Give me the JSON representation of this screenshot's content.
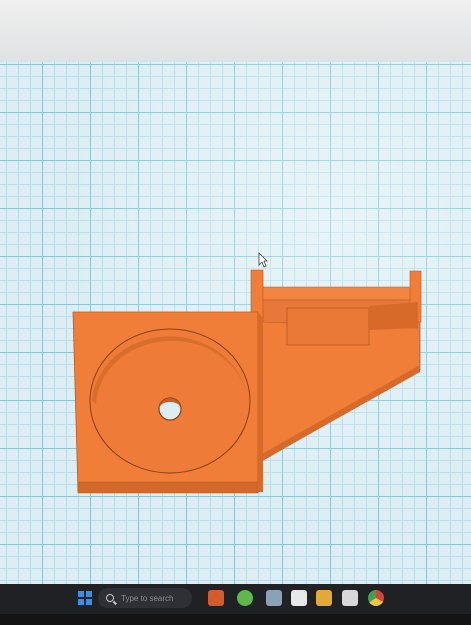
{
  "taskbar": {
    "search_placeholder": "Type to search",
    "apps": [
      {
        "name": "files-app-icon",
        "color": "#d65a2c"
      },
      {
        "name": "photos-app-icon",
        "color": "#5fb84a"
      },
      {
        "name": "explorer-icon",
        "color": "#8aa2b8"
      },
      {
        "name": "text-app-icon",
        "color": "#e8e8e8"
      },
      {
        "name": "folder-icon",
        "color": "#e3a936"
      },
      {
        "name": "notes-app-icon",
        "color": "#d8d8d8"
      },
      {
        "name": "chrome-icon",
        "color": "#d9443a"
      }
    ]
  },
  "colors": {
    "model_face": "#f07d38",
    "model_top": "#f2853f",
    "model_edge": "#d86a29",
    "model_dark": "#c55f22",
    "grid_background": "#dceef3"
  }
}
